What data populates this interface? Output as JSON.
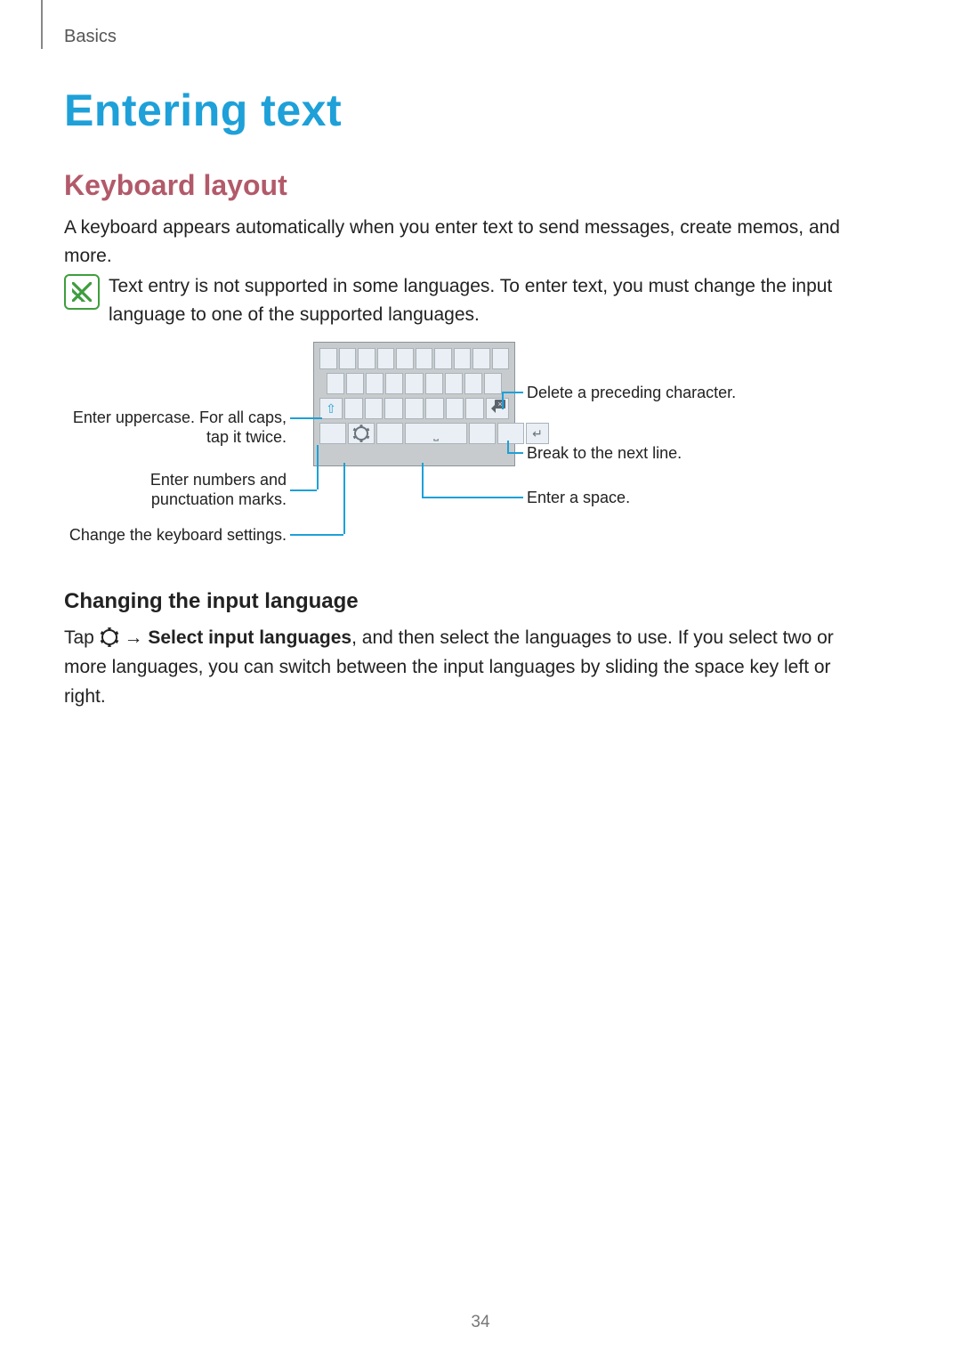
{
  "header": {
    "section": "Basics"
  },
  "title": "Entering text",
  "subtitle": "Keyboard layout",
  "intro": "A keyboard appears automatically when you enter text to send messages, create memos, and more.",
  "note": "Text entry is not supported in some languages. To enter text, you must change the input language to one of the supported languages.",
  "callouts": {
    "uppercase": "Enter uppercase. For all caps, tap it twice.",
    "numbers": "Enter numbers and punctuation marks.",
    "settings": "Change the keyboard settings.",
    "delete": "Delete a preceding character.",
    "nextline": "Break to the next line.",
    "space": "Enter a space."
  },
  "section3": {
    "heading": "Changing the input language",
    "p_pre": "Tap ",
    "p_mid_bold": " → Select input languages",
    "p_post": ", and then select the languages to use. If you select two or more languages, you can switch between the input languages by sliding the space key left or right."
  },
  "pagenum": "34"
}
